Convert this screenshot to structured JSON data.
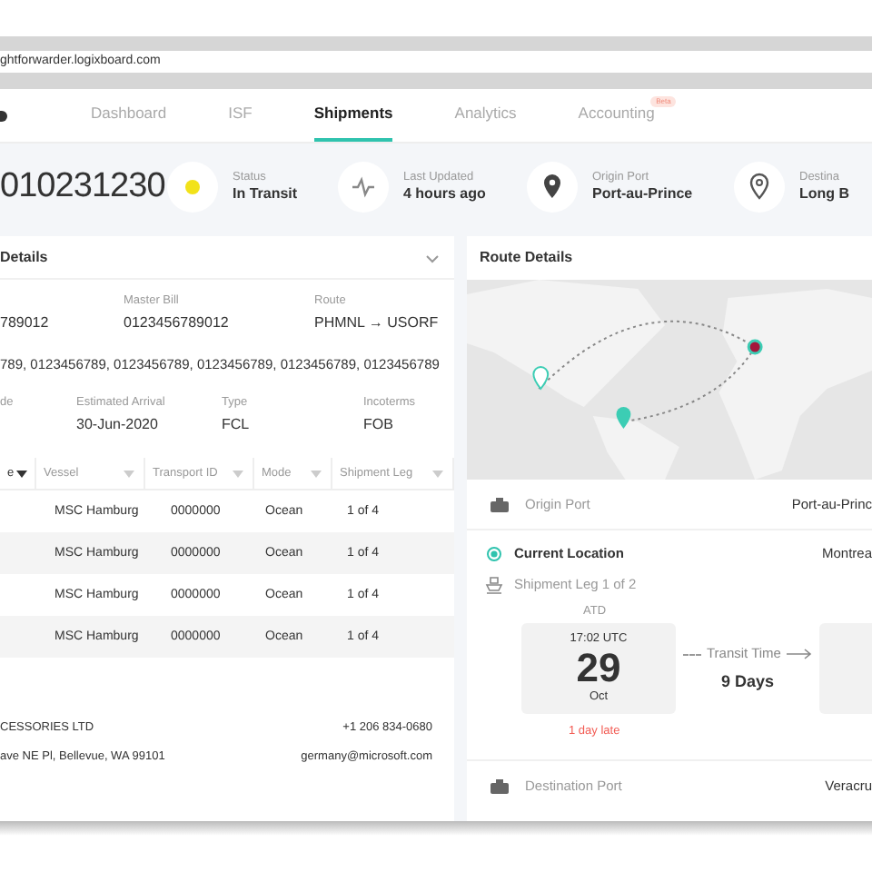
{
  "browser": {
    "url": "ghtforwarder.logixboard.com"
  },
  "nav": {
    "tabs": [
      {
        "label": "Dashboard",
        "selected": false
      },
      {
        "label": "ISF",
        "selected": false
      },
      {
        "label": "Shipments",
        "selected": true
      },
      {
        "label": "Analytics",
        "selected": false
      },
      {
        "label": "Accounting",
        "selected": false,
        "badge": "Beta"
      }
    ]
  },
  "header": {
    "shipment_id": "010231230",
    "stats": [
      {
        "kind": "status",
        "label": "Status",
        "value": "In Transit"
      },
      {
        "kind": "activity",
        "label": "Last Updated",
        "value": "4 hours ago"
      },
      {
        "kind": "pin",
        "label": "Origin Port",
        "value": "Port-au-Prince"
      },
      {
        "kind": "pin-outline",
        "label": "Destina",
        "value": "Long B"
      }
    ]
  },
  "details": {
    "title": "Details",
    "row_1": [
      {
        "value": "789012"
      },
      {
        "label": "Master Bill",
        "value": "0123456789012"
      },
      {
        "label": "Route",
        "value": "PHMNL → USORF"
      }
    ],
    "references": "789, 0123456789, 0123456789, 0123456789, 0123456789, 0123456789",
    "row_2": [
      {
        "label": "de"
      },
      {
        "label": "Estimated Arrival",
        "value": "30-Jun-2020"
      },
      {
        "label": "Type",
        "value": "FCL"
      },
      {
        "label": "Incoterms",
        "value": "FOB"
      }
    ],
    "table": {
      "columns": [
        {
          "label": "e",
          "sorted": true
        },
        {
          "label": "Vessel",
          "sorted": false
        },
        {
          "label": "Transport ID",
          "sorted": false
        },
        {
          "label": "Mode",
          "sorted": false
        },
        {
          "label": "Shipment Leg",
          "sorted": false
        }
      ],
      "rows": [
        [
          "",
          "MSC Hamburg",
          "0000000",
          "Ocean",
          "1 of 4"
        ],
        [
          "",
          "MSC Hamburg",
          "0000000",
          "Ocean",
          "1 of 4"
        ],
        [
          "",
          "MSC Hamburg",
          "0000000",
          "Ocean",
          "1 of 4"
        ],
        [
          "",
          "MSC Hamburg",
          "0000000",
          "Ocean",
          "1 of 4"
        ]
      ]
    },
    "contact": {
      "name": "CESSORIES LTD",
      "address": "ave NE Pl, Bellevue, WA 99101",
      "phone": "+1 206 834-0680",
      "email": "germany@microsoft.com"
    }
  },
  "route": {
    "title": "Route Details",
    "origin": {
      "label": "Origin Port",
      "value": "Port-au-Princ"
    },
    "current": {
      "label": "Current Location",
      "value": "Montrea"
    },
    "leg": "Shipment Leg 1 of 2",
    "atd": "ATD",
    "departure": {
      "time": "17:02 UTC",
      "day": "29",
      "month": "Oct"
    },
    "transit": {
      "label": "Transit Time",
      "value": "9 Days"
    },
    "late": "1 day late",
    "destination": {
      "label": "Destination Port",
      "value": "Veracru"
    }
  }
}
